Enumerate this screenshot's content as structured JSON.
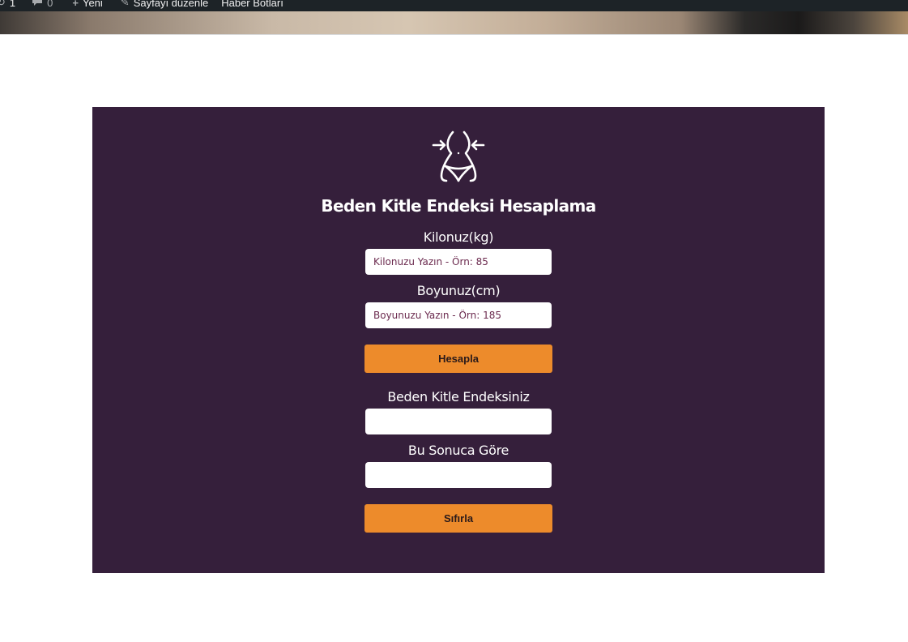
{
  "admin_bar": {
    "items": [
      {
        "icon": "updates-icon",
        "label": "1"
      },
      {
        "icon": "comment-icon",
        "label": "0"
      },
      {
        "icon": "plus-icon",
        "label": "Yeni"
      },
      {
        "icon": "pencil-icon",
        "label": "Sayfayı düzenle"
      },
      {
        "icon": "",
        "label": "Haber Botları"
      }
    ]
  },
  "calculator": {
    "icon": "waist-slim-icon",
    "title": "Beden Kitle Endeksi Hesaplama",
    "weight_label": "Kilonuz(kg)",
    "weight_placeholder": "Kilonuzu Yazın - Örn: 85",
    "weight_value": "",
    "height_label": "Boyunuz(cm)",
    "height_placeholder": "Boyunuzu Yazın - Örn: 185",
    "height_value": "",
    "calculate_button": "Hesapla",
    "bmi_label": "Beden Kitle Endeksiniz",
    "bmi_value": "",
    "result_label": "Bu Sonuca Göre",
    "result_value": "",
    "reset_button": "Sıfırla"
  },
  "colors": {
    "admin_bar_bg": "#1d2327",
    "panel_bg": "#351f3b",
    "button_bg": "#ed8b2b",
    "placeholder_text": "#6b2a4e"
  }
}
